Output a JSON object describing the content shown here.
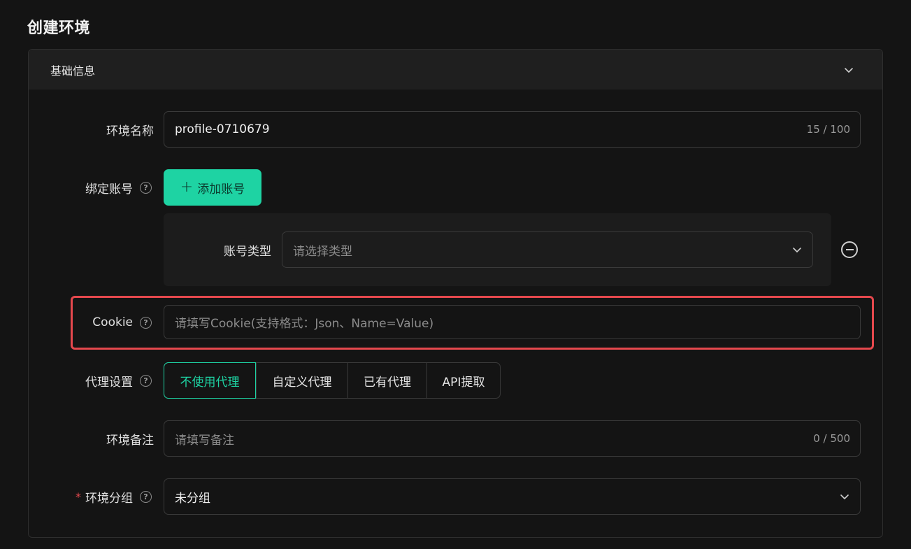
{
  "page": {
    "title": "创建环境"
  },
  "section": {
    "title": "基础信息"
  },
  "fields": {
    "name": {
      "label": "环境名称",
      "value": "profile-0710679",
      "count": "15 / 100"
    },
    "account": {
      "label": "绑定账号",
      "add_label": "添加账号"
    },
    "account_type": {
      "label": "账号类型",
      "placeholder": "请选择类型"
    },
    "cookie": {
      "label": "Cookie",
      "placeholder": "请填写Cookie(支持格式：Json、Name=Value)"
    },
    "proxy": {
      "label": "代理设置",
      "options": [
        "不使用代理",
        "自定义代理",
        "已有代理",
        "API提取"
      ],
      "selected": "不使用代理"
    },
    "remark": {
      "label": "环境备注",
      "placeholder": "请填写备注",
      "count": "0 / 500"
    },
    "group": {
      "label": "环境分组",
      "required_mark": "*",
      "value": "未分组"
    }
  },
  "colors": {
    "accent": "#1ed3a3",
    "highlight": "#e5484d",
    "background": "#141414"
  },
  "icons": [
    "chevron-down-icon",
    "help-icon",
    "plus-icon",
    "minus-circle-icon"
  ]
}
